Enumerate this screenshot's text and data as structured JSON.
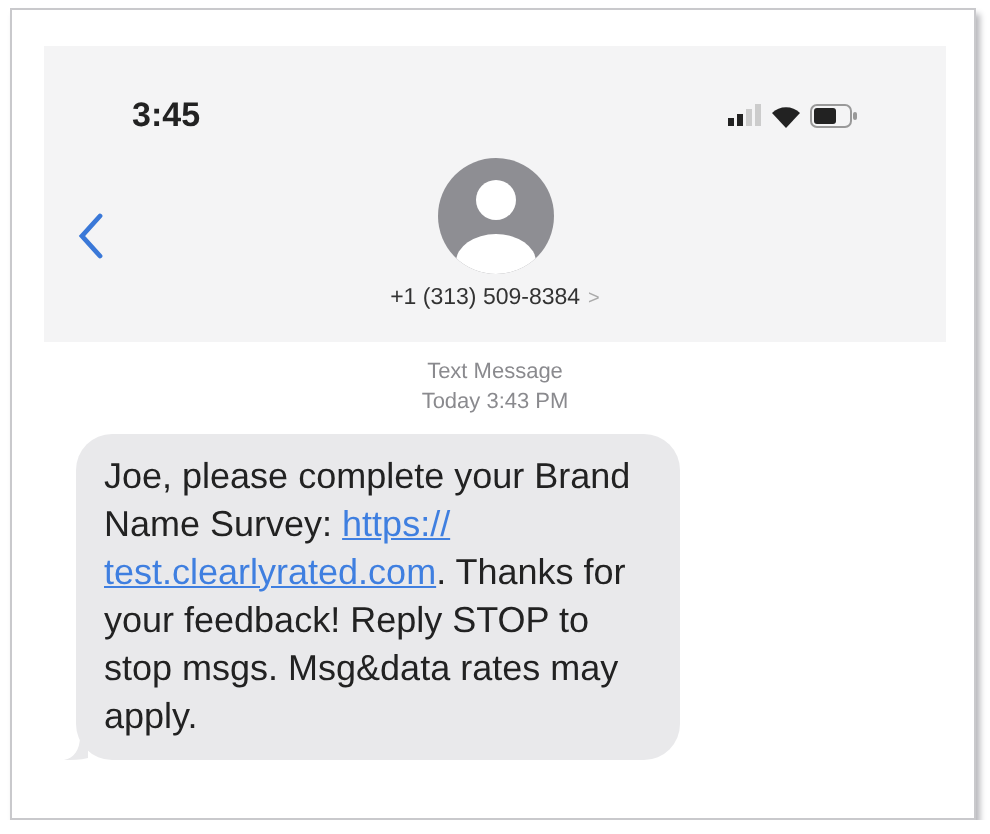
{
  "status_bar": {
    "time": "3:45"
  },
  "contact": {
    "phone": "+1 (313) 509-8384",
    "chevron": ">"
  },
  "thread": {
    "label": "Text Message",
    "timestamp": "Today 3:43 PM"
  },
  "message": {
    "parts": [
      {
        "kind": "text",
        "text": "Joe, please complete your Brand Name Survey: "
      },
      {
        "kind": "link",
        "text": "https://"
      },
      {
        "kind": "link",
        "text": "test.clearlyrated.com"
      },
      {
        "kind": "text",
        "text": ". Thanks for your feedback! Reply STOP to stop msgs. Msg&data rates may apply."
      }
    ]
  }
}
